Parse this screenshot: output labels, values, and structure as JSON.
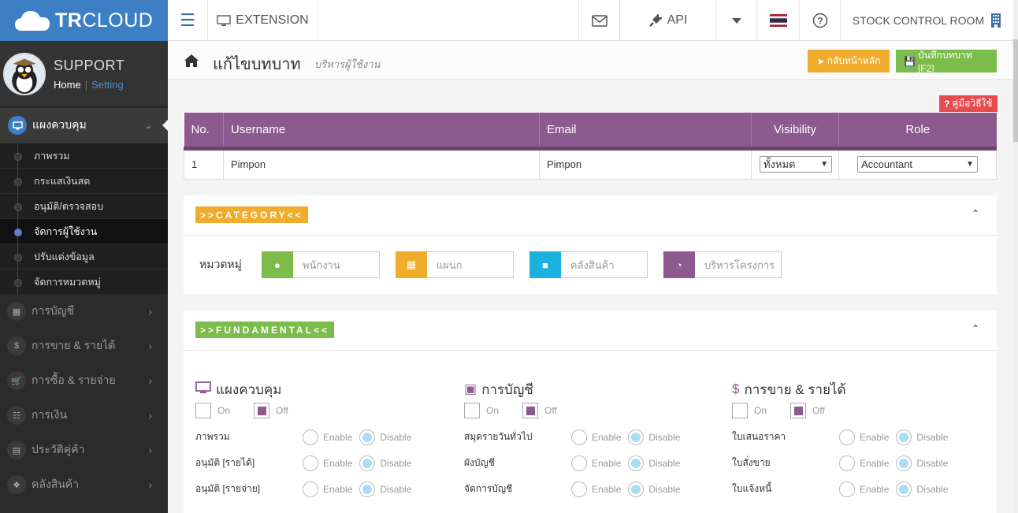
{
  "brand": {
    "logo_bold": "TR",
    "logo_light": "CLOUD"
  },
  "profile": {
    "name": "SUPPORT",
    "home": "Home",
    "separator": "|",
    "setting": "Setting"
  },
  "sidebar": {
    "active_menu": {
      "label": "แผงควบคุม",
      "icon": "monitor-icon"
    },
    "sub_items": [
      {
        "label": "ภาพรวม",
        "active": false
      },
      {
        "label": "กระแสเงินสด",
        "active": false
      },
      {
        "label": "อนุมัติ/ตรวจสอบ",
        "active": false
      },
      {
        "label": "จัดการผู้ใช้งาน",
        "active": true
      },
      {
        "label": "ปรับแต่งข้อมูล",
        "active": false
      },
      {
        "label": "จัดการหมวดหมู่",
        "active": false
      }
    ],
    "menus": [
      {
        "label": "การบัญชี",
        "icon": "book-icon"
      },
      {
        "label": "การขาย & รายได้",
        "icon": "dollar-icon"
      },
      {
        "label": "การซื้อ & รายจ่าย",
        "icon": "cart-icon"
      },
      {
        "label": "การเงิน",
        "icon": "calendar-icon"
      },
      {
        "label": "ประวัติคู่ค้า",
        "icon": "contact-book-icon"
      },
      {
        "label": "คลังสินค้า",
        "icon": "cubes-icon"
      }
    ]
  },
  "topbar": {
    "extension": "EXTENSION",
    "api": "API",
    "stock": "STOCK CONTROL ROOM"
  },
  "page": {
    "title": "แก้ไขบทบาท",
    "subtitle": "บริหารผู้ใช้งาน",
    "back_button": "กลับหน้าหลัก",
    "save_button": "บันทึกบทบาท [F2]",
    "help_button": "คู่มือวิธีใช้"
  },
  "user_table": {
    "headers": [
      "No.",
      "Username",
      "Email",
      "Visibility",
      "Role"
    ],
    "rows": [
      {
        "no": "1",
        "username": "Pimpon",
        "email": "Pimpon",
        "visibility": "ทั้งหมด",
        "role": "Accountant"
      }
    ]
  },
  "category": {
    "tag": ">>CATEGORY<<",
    "label": "หมวดหมู่",
    "inputs": [
      {
        "placeholder": "พนักงาน",
        "icon": "user-icon",
        "color": "#7cbc4b"
      },
      {
        "placeholder": "แผนก",
        "icon": "building-icon",
        "color": "#f0ad2d"
      },
      {
        "placeholder": "คลังสินค้า",
        "icon": "cube-icon",
        "color": "#1ab0e0"
      },
      {
        "placeholder": "บริหารโครงการ",
        "icon": "pie-chart-icon",
        "color": "#8c5a8e"
      }
    ]
  },
  "fundamental": {
    "tag": ">>FUNDAMENTAL<<",
    "on_label": "On",
    "off_label": "Off",
    "enable_label": "Enable",
    "disable_label": "Disable",
    "columns": [
      {
        "title": "แผงควบคุม",
        "icon": "monitor-icon",
        "rows": [
          "ภาพรวม",
          "อนุมัติ [รายได้]",
          "อนุมัติ [รายจ่าย]"
        ]
      },
      {
        "title": "การบัญชี",
        "icon": "book-icon",
        "rows": [
          "สมุดรายวันทั่วไป",
          "ผังบัญชี",
          "จัดการบัญชี"
        ]
      },
      {
        "title": "การขาย & รายได้",
        "icon": "dollar-icon",
        "rows": [
          "ใบเสนอราคา",
          "ใบสั่งขาย",
          "ใบแจ้งหนี้"
        ]
      }
    ]
  },
  "colors": {
    "brand": "#3c7fc4",
    "purple": "#8c5a8e",
    "green": "#7cbc4b",
    "orange": "#f0ad2d",
    "red": "#e74c4c"
  }
}
